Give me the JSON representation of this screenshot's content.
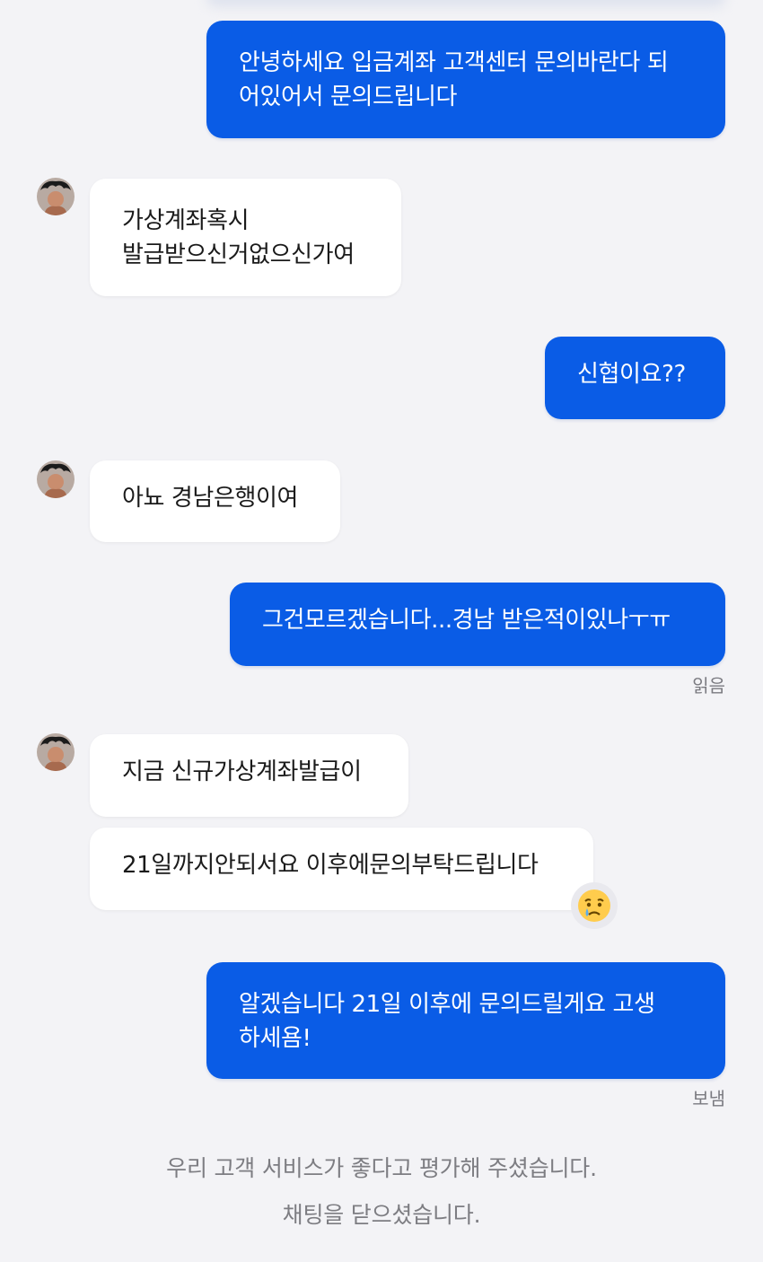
{
  "messages": [
    {
      "sender": "user",
      "text": "안녕하세요 입금계좌 고객센터 문의바란다 되\n어있어서 문의드립니다"
    },
    {
      "sender": "agent",
      "text": "가상계좌혹시\n발급받으신거없으신가여"
    },
    {
      "sender": "user",
      "text": "신협이요??"
    },
    {
      "sender": "agent",
      "text": "아뇨 경남은행이여"
    },
    {
      "sender": "user",
      "text": "그건모르겠습니다...경남 받은적이있나ㅜㅠ"
    },
    {
      "sender": "agent",
      "text": "지금 신규가상계좌발급이"
    },
    {
      "sender": "agent",
      "text": "21일까지안되서요 이후에문의부탁드립니다"
    },
    {
      "sender": "user",
      "text": "알겠습니다 21일 이후에 문의드릴게요 고생\n하세욤!"
    }
  ],
  "status": {
    "read": "읽음",
    "sent": "보냄"
  },
  "reaction": {
    "icon": "crying-face-emoji",
    "color": "#ffcc4d"
  },
  "system": {
    "rating_notice": "우리 고객 서비스가 좋다고 평가해 주셨습니다.",
    "closed_notice": "채팅을 닫으셨습니다."
  },
  "colors": {
    "outgoing_bubble": "#0a5ce6",
    "incoming_bubble": "#ffffff",
    "background": "#f3f3f6"
  }
}
